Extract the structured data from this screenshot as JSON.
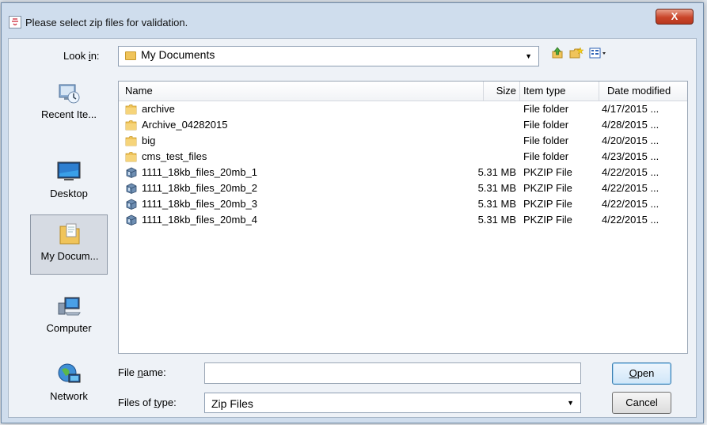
{
  "window": {
    "title": "Please select zip files for validation.",
    "close_glyph": "X"
  },
  "lookin": {
    "label_pre": "Look ",
    "label_key": "i",
    "label_post": "n:",
    "value": "My Documents"
  },
  "toolbar": {
    "up_icon": "up-folder-icon",
    "new_folder_icon": "new-folder-icon",
    "view_icon": "view-menu-icon"
  },
  "places": [
    {
      "label": "Recent Ite...",
      "icon": "recent-items-icon"
    },
    {
      "label": "Desktop",
      "icon": "desktop-icon"
    },
    {
      "label": "My Docum...",
      "icon": "my-documents-icon",
      "selected": true
    },
    {
      "label": "Computer",
      "icon": "computer-icon"
    },
    {
      "label": "Network",
      "icon": "network-icon"
    }
  ],
  "filelist": {
    "columns": {
      "name": "Name",
      "size": "Size",
      "type": "Item type",
      "date": "Date modified"
    },
    "rows": [
      {
        "name": "archive",
        "size": "",
        "type": "File folder",
        "date": "4/17/2015 ...",
        "kind": "folder"
      },
      {
        "name": "Archive_04282015",
        "size": "",
        "type": "File folder",
        "date": "4/28/2015 ...",
        "kind": "folder"
      },
      {
        "name": "big",
        "size": "",
        "type": "File folder",
        "date": "4/20/2015 ...",
        "kind": "folder"
      },
      {
        "name": "cms_test_files",
        "size": "",
        "type": "File folder",
        "date": "4/23/2015 ...",
        "kind": "folder"
      },
      {
        "name": "1111_18kb_files_20mb_1",
        "size": "5.31 MB",
        "type": "PKZIP File",
        "date": "4/22/2015 ...",
        "kind": "zip"
      },
      {
        "name": "1111_18kb_files_20mb_2",
        "size": "5.31 MB",
        "type": "PKZIP File",
        "date": "4/22/2015 ...",
        "kind": "zip"
      },
      {
        "name": "1111_18kb_files_20mb_3",
        "size": "5.31 MB",
        "type": "PKZIP File",
        "date": "4/22/2015 ...",
        "kind": "zip"
      },
      {
        "name": "1111_18kb_files_20mb_4",
        "size": "5.31 MB",
        "type": "PKZIP File",
        "date": "4/22/2015 ...",
        "kind": "zip"
      }
    ]
  },
  "filename": {
    "label_pre": "File ",
    "label_key": "n",
    "label_post": "ame:",
    "value": ""
  },
  "filetype": {
    "label_pre": "Files of ",
    "label_key": "t",
    "label_post": "ype:",
    "value": "Zip Files"
  },
  "buttons": {
    "open_key": "O",
    "open_rest": "pen",
    "cancel": "Cancel"
  },
  "colors": {
    "folder": "#f0c45a",
    "selection_bg": "#d6dbe3",
    "close_red": "#c9452a"
  }
}
